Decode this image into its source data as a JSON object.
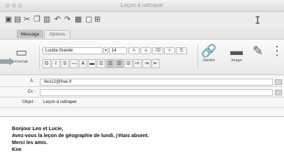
{
  "window": {
    "title": "Leçon à rattraper"
  },
  "tabs": [
    {
      "label": "Message"
    },
    {
      "label": "Options"
    }
  ],
  "ribbon": {
    "font_name": "Lucida Grande",
    "font_size": "14",
    "left_button_label": "Format",
    "mid_button_label": "Joindre",
    "right_button_label": "Image"
  },
  "header_fields": {
    "to_label": "À :",
    "to_value": "Ileo12@free.fr",
    "cc_label": "Cc :",
    "cc_value": "",
    "subject_label": "Objet :",
    "subject_value": "Leçon à rattraper"
  },
  "body": {
    "line1": "Bonjour Leo et Lucie,",
    "line2": "Avez-vous la leçon de géographie de lundi, j'étais absent.",
    "line3": "Merci les amis.",
    "line4": "Kim"
  },
  "icons": [
    "save-icon",
    "print-icon",
    "cut-icon",
    "copy-icon",
    "paste-icon",
    "undo-icon",
    "redo-icon",
    "text-cursor-icon"
  ]
}
